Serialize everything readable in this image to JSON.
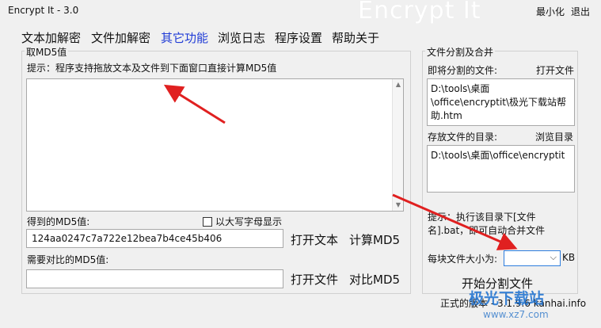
{
  "window": {
    "title": "Encrypt It - 3.0",
    "watermark": "Encrypt It",
    "minimize_label": "最小化",
    "exit_label": "退出"
  },
  "tabs": [
    {
      "label": "文本加解密",
      "active": false
    },
    {
      "label": "文件加解密",
      "active": false
    },
    {
      "label": "其它功能",
      "active": true
    },
    {
      "label": "浏览日志",
      "active": false
    },
    {
      "label": "程序设置",
      "active": false
    },
    {
      "label": "帮助关于",
      "active": false
    }
  ],
  "md5": {
    "group_title": "取MD5值",
    "hint": "提示：程序支持拖放文本及文件到下面窗口直接计算MD5值",
    "text_value": "",
    "result_label": "得到的MD5值:",
    "uppercase_label": "以大写字母显示",
    "uppercase_checked": false,
    "result_value": "124aa0247c7a722e12bea7b4ce45b406",
    "open_text_label": "打开文本",
    "compute_label": "计算MD5",
    "compare_label": "需要对比的MD5值:",
    "compare_value": "",
    "open_file_label": "打开文件",
    "compare_button_label": "对比MD5"
  },
  "split": {
    "group_title": "文件分割及合并",
    "source_label": "即将分割的文件:",
    "open_file_label": "打开文件",
    "source_value": "D:\\tools\\桌面\\office\\encryptit\\极光下载站帮助.htm",
    "target_label": "存放文件的目录:",
    "browse_label": "浏览目录",
    "target_value": "D:\\tools\\桌面\\office\\encryptit",
    "hint": "提示：执行该目录下[文件名].bat，即可自动合并文件",
    "size_label": "每块文件大小为:",
    "size_value": "",
    "size_unit": "KB",
    "start_label": "开始分割文件"
  },
  "footer": {
    "version_text": "正式的版本 - 3.1.9.6 kanhai.info"
  },
  "overlay": {
    "logo_text": "极光下载站",
    "url_text": "www.xz7.com",
    "arrow_color": "#e02020"
  }
}
